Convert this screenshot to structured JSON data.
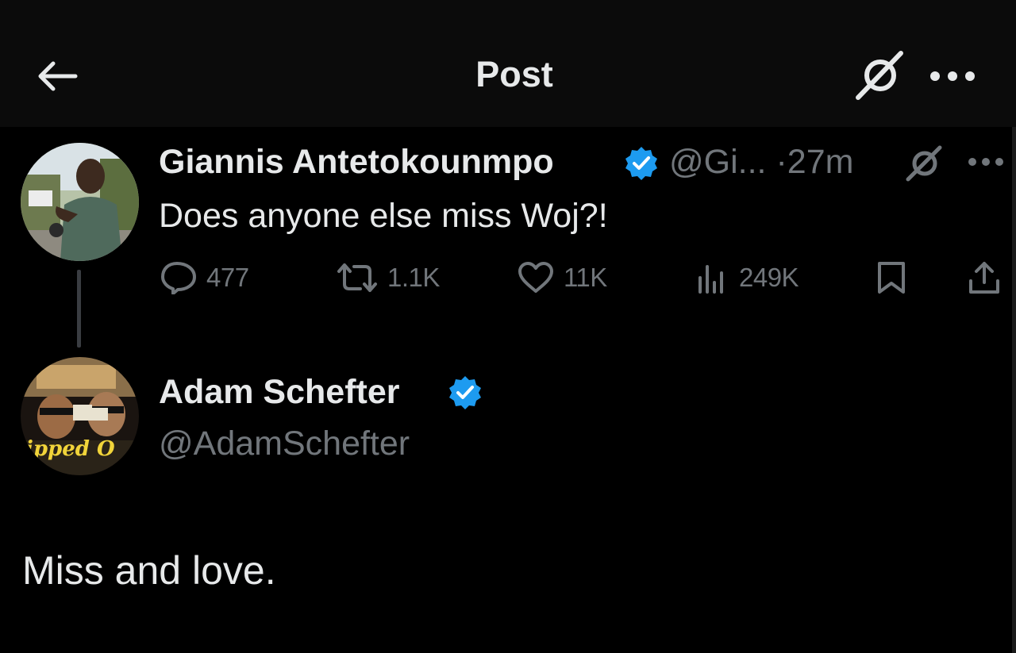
{
  "header": {
    "title": "Post",
    "back_icon": "arrow-left-icon",
    "grok_icon": "grok-icon",
    "more_icon": "more-horizontal-icon"
  },
  "original_post": {
    "author_name": "Giannis Antetokounmpo",
    "handle": "@Gi...",
    "separator": "·",
    "time": "27m",
    "verified": true,
    "text": "Does anyone else miss Woj?!",
    "actions": {
      "replies": "477",
      "reposts": "1.1K",
      "likes": "11K",
      "views": "249K"
    }
  },
  "reply": {
    "author_name": "Adam Schefter",
    "handle": "@AdamSchefter",
    "verified": true,
    "text": "Miss and love.",
    "avatar_caption": "ipped O"
  },
  "colors": {
    "background": "#000000",
    "header_background": "#0b0b0b",
    "primary_text": "#e7e9ea",
    "secondary_text": "#71767b",
    "verified_blue": "#1d9bf0",
    "thread_line": "#3a3d42"
  }
}
